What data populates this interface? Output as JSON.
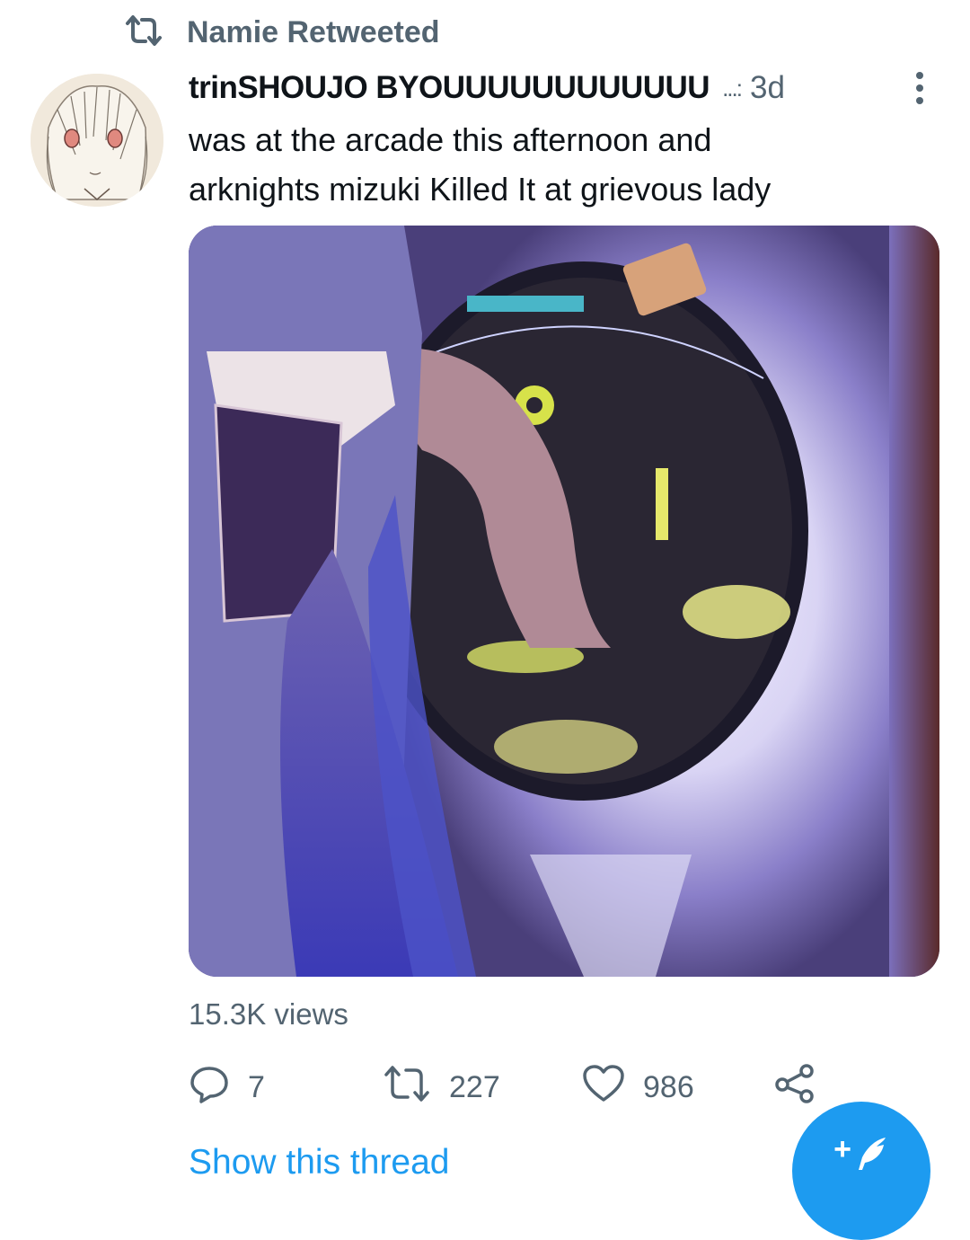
{
  "retweet_banner": {
    "icon": "retweet-icon",
    "text": "Namie Retweeted"
  },
  "tweet": {
    "author": {
      "display_name": "trinSHOUJO BYOUUUUUUUUUUUU",
      "name_suffix": "...:",
      "avatar_icon": "avatar-sketch"
    },
    "time_ago": "3d",
    "more_icon": "more-vertical-icon",
    "text_lines": [
      "was at the arcade this afternoon and",
      "arknights mizuki Killed It at grievous lady"
    ],
    "media": {
      "type": "video-thumbnail",
      "description_icon": "arcade-video-thumbnail"
    },
    "views": "15.3K views",
    "actions": {
      "reply": {
        "icon": "reply-icon",
        "count": "7"
      },
      "retweet": {
        "icon": "retweet-icon",
        "count": "227"
      },
      "like": {
        "icon": "heart-icon",
        "count": "986"
      },
      "share": {
        "icon": "share-icon"
      }
    },
    "show_thread": "Show this thread"
  },
  "compose_button": {
    "icon": "compose-feather-icon",
    "label": "+"
  },
  "colors": {
    "secondary_text": "#536471",
    "primary_text": "#0f1419",
    "accent": "#1d9bf0"
  }
}
